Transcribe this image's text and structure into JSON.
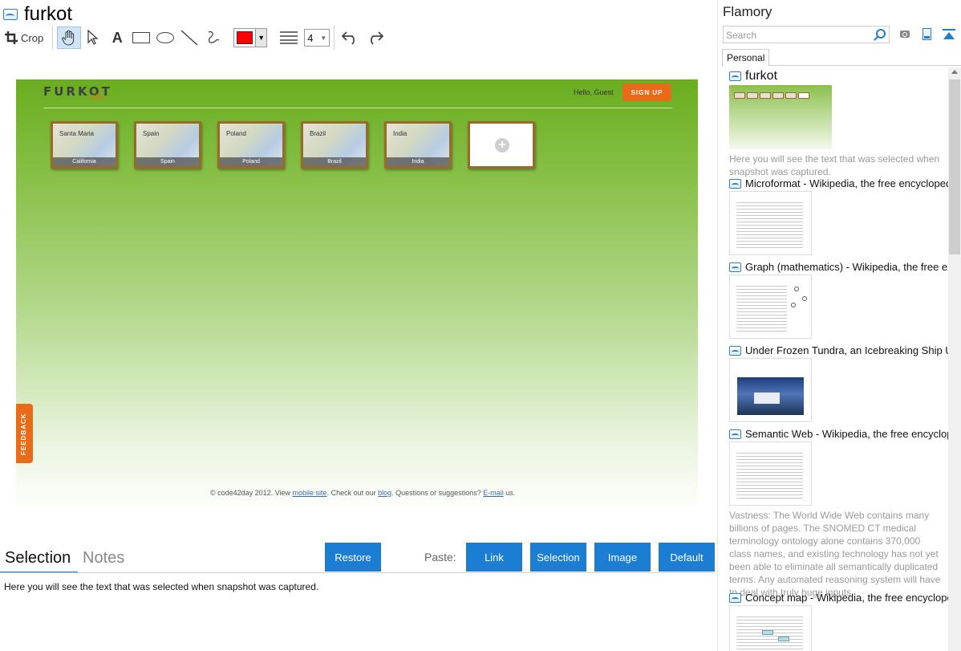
{
  "window": {
    "title": "furkot"
  },
  "toolbar": {
    "crop_label": "Crop",
    "text_tool_glyph": "A",
    "accent_color": "#ff0000",
    "line_width": "4"
  },
  "snapshot": {
    "logo": "FURKOT",
    "logo_plus": "plus",
    "greeting": "Hello, Guest",
    "signup": "SIGN UP",
    "trips": [
      {
        "caption": "California",
        "map_label": "Santa Maria"
      },
      {
        "caption": "Spain",
        "map_label": "Spain"
      },
      {
        "caption": "Poland",
        "map_label": "Poland"
      },
      {
        "caption": "Brazil",
        "map_label": "Brazil"
      },
      {
        "caption": "India",
        "map_label": "India"
      }
    ],
    "add_glyph": "+",
    "feedback": "FEEDBACK",
    "footer": {
      "prefix": "© code42day 2012. View ",
      "mobile_link": "mobile site",
      "mid": ". Check out our ",
      "blog_link": "blog",
      "mid2": ". Questions or suggestions? ",
      "email_link": "E-mail",
      "suffix": " us."
    }
  },
  "bottom": {
    "tab_selection": "Selection",
    "tab_notes": "Notes",
    "restore": "Restore",
    "paste_label": "Paste:",
    "paste_link": "Link",
    "paste_selection": "Selection",
    "paste_image": "Image",
    "paste_default": "Default",
    "selection_text": "Here you will see the text that was selected when snapshot was captured."
  },
  "sidebar": {
    "app_name": "Flamory",
    "search_placeholder": "Search",
    "tab": "Personal",
    "items": [
      {
        "title": "furkot",
        "desc": "Here you will see the text that was selected when snapshot was captured."
      },
      {
        "title": "Microformat - Wikipedia, the free encyclopedia"
      },
      {
        "title": "Graph (mathematics) - Wikipedia, the free encyc"
      },
      {
        "title": "Under Frozen Tundra, an Icebreaking Ship Unco"
      },
      {
        "title": "Semantic Web - Wikipedia, the free encycloped",
        "desc": "Vastness: The World Wide Web contains many billions of pages. The SNOMED CT medical terminology ontology alone contains 370,000 class names, and existing technology has not yet been able to eliminate all semantically duplicated terms. Any automated reasoning system will have to deal with truly huge inputs."
      },
      {
        "title": "Concept map - Wikipedia, the free encyclopedi"
      }
    ]
  }
}
